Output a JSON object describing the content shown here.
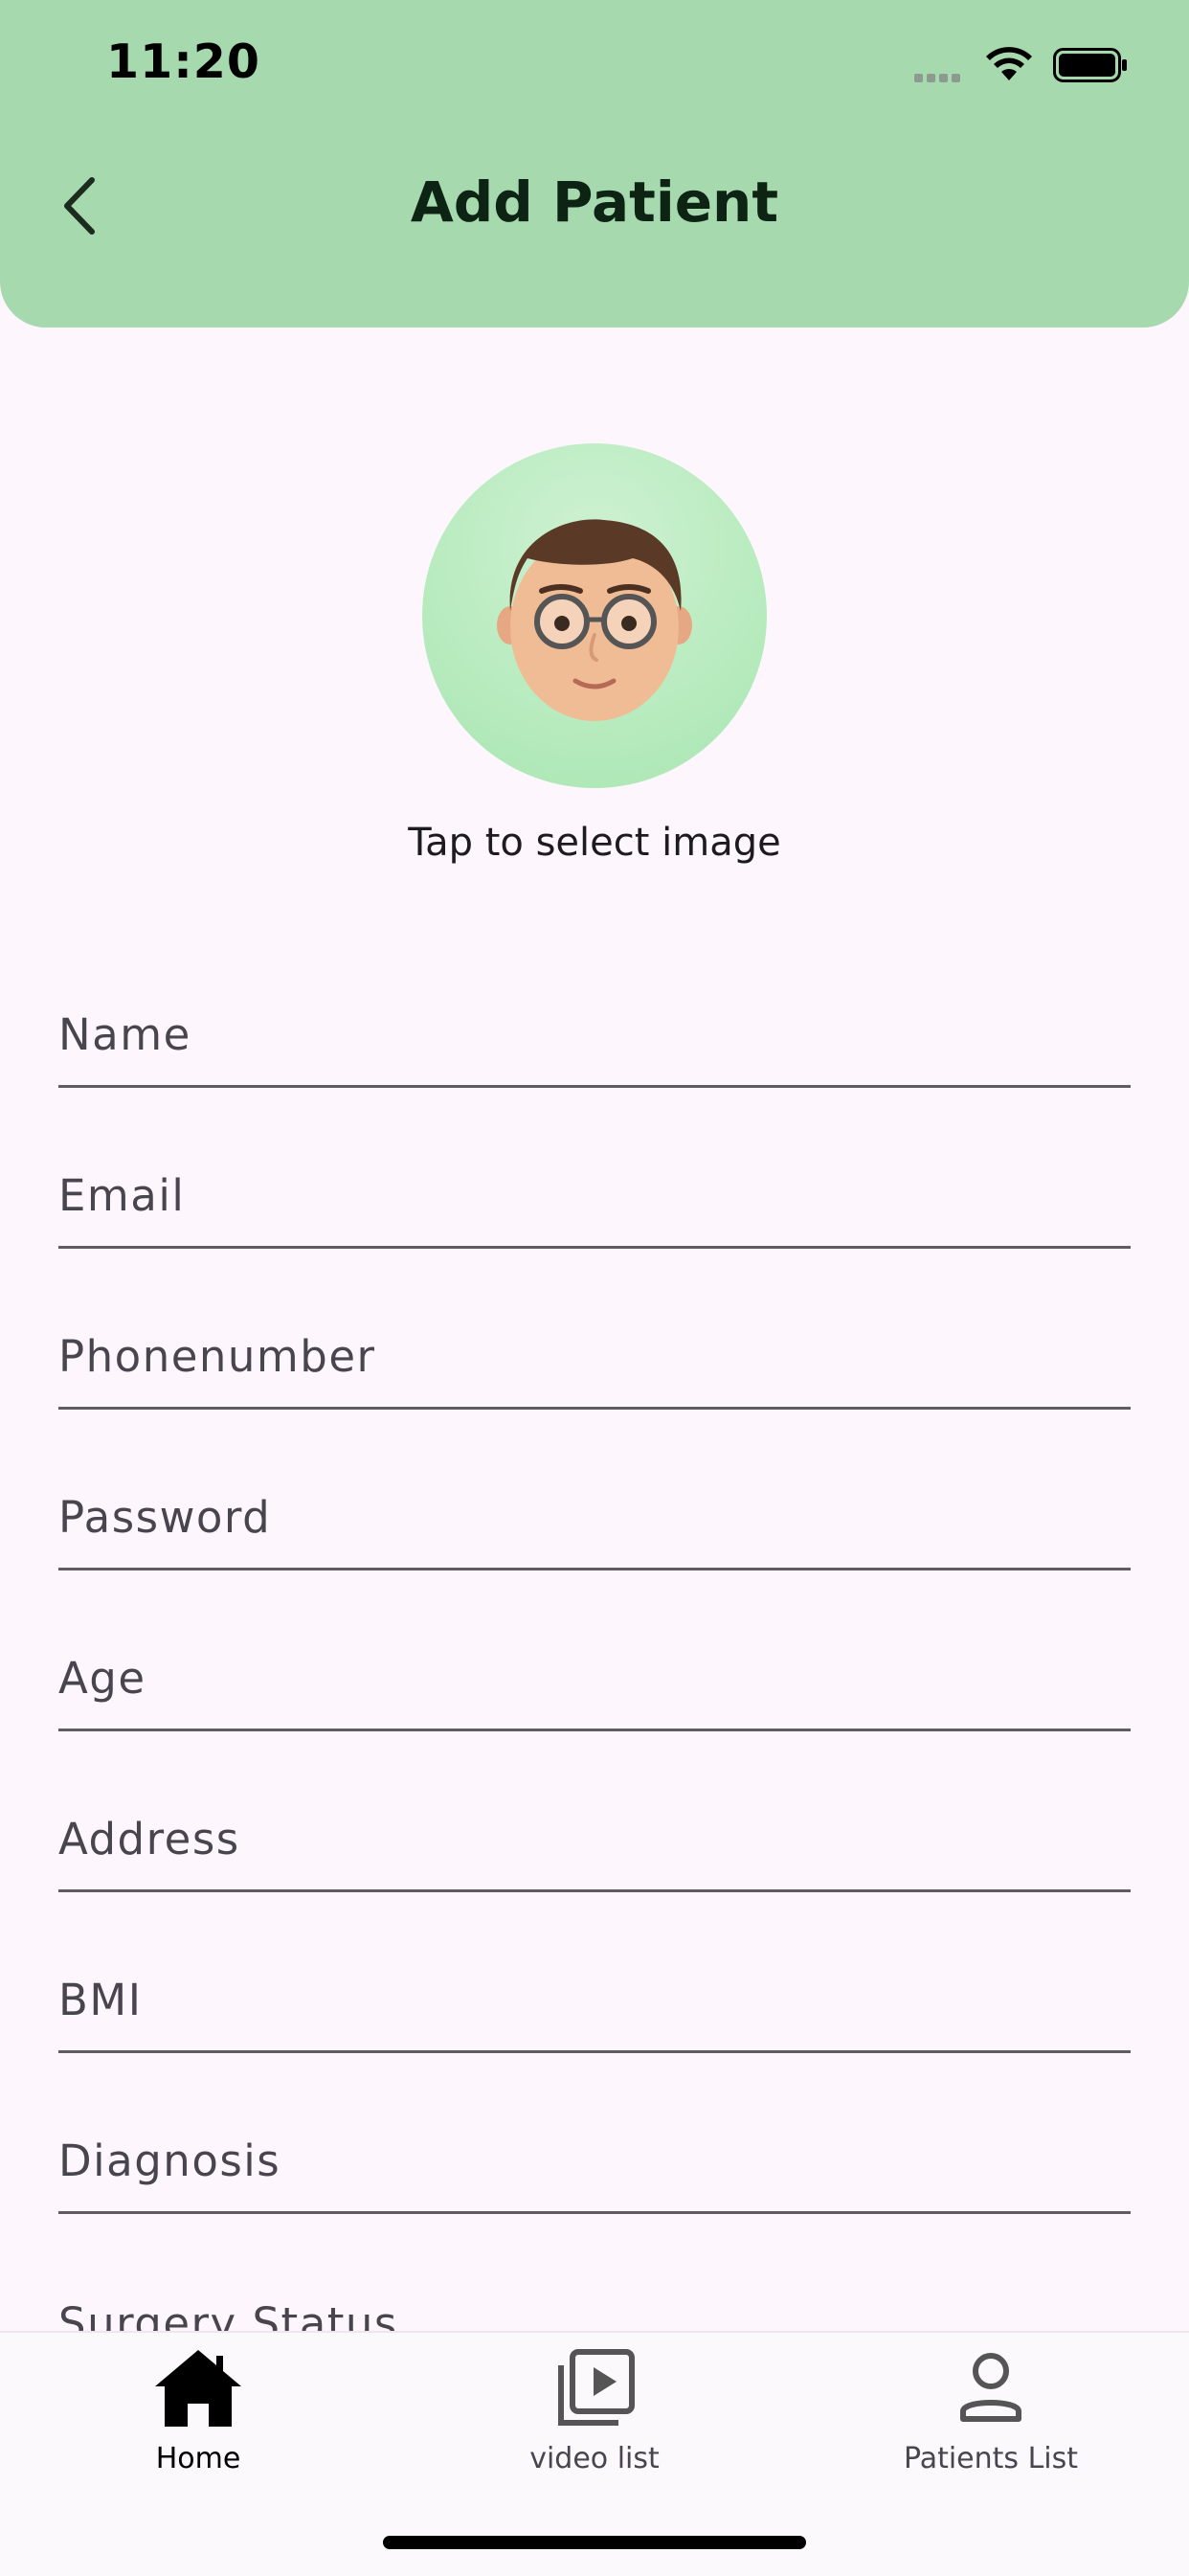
{
  "status_bar": {
    "time": "11:20"
  },
  "header": {
    "title": "Add Patient",
    "back_icon": "chevron-left-icon"
  },
  "avatar": {
    "hint": "Tap to select image",
    "icon": "memoji-avatar"
  },
  "form": {
    "fields": [
      {
        "placeholder": "Name",
        "value": ""
      },
      {
        "placeholder": "Email",
        "value": ""
      },
      {
        "placeholder": "Phonenumber",
        "value": ""
      },
      {
        "placeholder": "Password",
        "value": ""
      },
      {
        "placeholder": "Age",
        "value": ""
      },
      {
        "placeholder": "Address",
        "value": ""
      },
      {
        "placeholder": "BMI",
        "value": ""
      },
      {
        "placeholder": "Diagnosis",
        "value": ""
      },
      {
        "placeholder": "Surgery Status",
        "value": ""
      }
    ]
  },
  "bottom_nav": {
    "items": [
      {
        "label": "Home",
        "icon": "home-icon",
        "active": true
      },
      {
        "label": "video list",
        "icon": "video-library-icon",
        "active": false
      },
      {
        "label": "Patients List",
        "icon": "person-icon",
        "active": false
      }
    ]
  },
  "colors": {
    "header_bg": "#a6d9ad",
    "page_bg": "#fdf7fd",
    "avatar_bg": "#b7ebbe",
    "field_underline": "#5f5c63"
  }
}
